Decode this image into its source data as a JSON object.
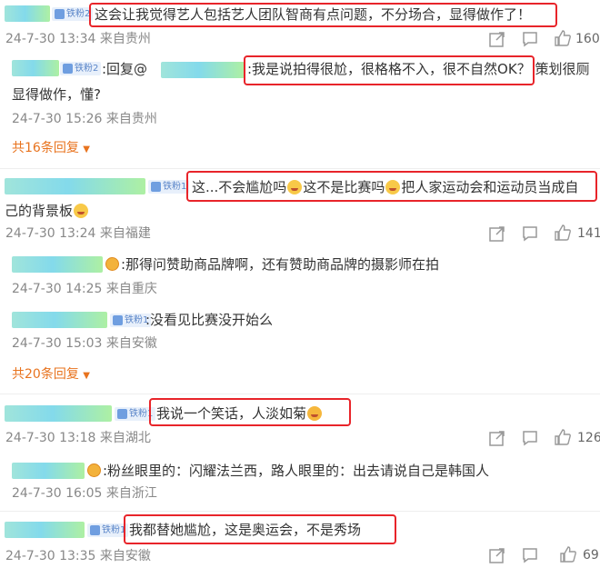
{
  "comments": [
    {
      "text": "这会让我觉得艺人包括艺人团队智商有点问题，不分场合，显得做作了！",
      "badge": "铁粉2",
      "meta": "24-7-30 13:34 来自贵州",
      "likes": "160",
      "replies": [
        {
          "badge": "铁粉2",
          "prefix": ":回复@",
          "text_line1": ":我是说拍得很尬，很格格不入，很不自然OK？ 策划很厕",
          "text_line2": "显得做作，懂?",
          "meta": "24-7-30 15:26 来自贵州"
        }
      ],
      "more_replies": "共16条回复"
    },
    {
      "text_line1_a": "这...不会尴尬吗",
      "text_line1_b": "这不是比赛吗",
      "text_line1_c": "把人家运动会和运动员当成自",
      "text_line2": "己的背景板",
      "badge": "铁粉1",
      "meta": "24-7-30 13:24 来自福建",
      "likes": "141",
      "replies": [
        {
          "text": ":那得问赞助商品牌啊，还有赞助商品牌的摄影师在拍",
          "meta": "24-7-30 14:25 来自重庆"
        },
        {
          "badge": "铁粉1",
          "text": ":没看见比赛没开始么",
          "meta": "24-7-30 15:03 来自安徽"
        }
      ],
      "more_replies": "共20条回复"
    },
    {
      "text": "我说一个笑话，人淡如菊",
      "badge": "铁粉1",
      "meta": "24-7-30 13:18 来自湖北",
      "likes": "126",
      "replies": [
        {
          "text": ":粉丝眼里的：闪耀法兰西，路人眼里的：出去请说自己是韩国人",
          "meta": "24-7-30 16:05 来自浙江"
        }
      ]
    },
    {
      "text": "我都替她尴尬，这是奥运会，不是秀场",
      "badge": "铁粉1",
      "meta": "24-7-30 13:35 来自安徽",
      "likes": "69"
    }
  ],
  "icons": [
    "share-icon",
    "comment-icon",
    "like-icon",
    "dropdown-triangle-icon",
    "laugh-cry-emoji",
    "sweat-emoji",
    "fan-avatar-icon"
  ],
  "colors": {
    "highlight": "#e8242a",
    "reply_link": "#e8731e",
    "meta": "#888888",
    "badge_bg": "#e8f0fb",
    "badge_text": "#5b86c9"
  }
}
